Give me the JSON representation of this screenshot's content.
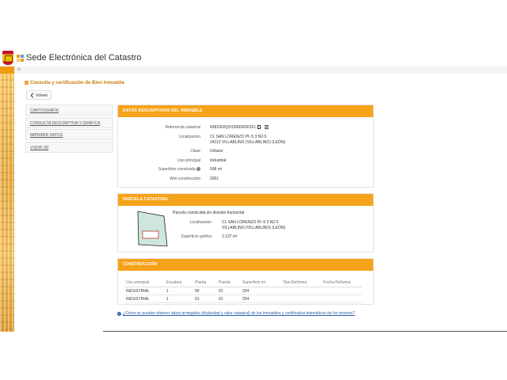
{
  "header": {
    "site_title": "Sede Electrónica del Catastro",
    "colors": {
      "accent": "#f5a31a",
      "title_text": "#c87d0e",
      "link": "#2b5ea7"
    }
  },
  "page": {
    "title": "Consulta y certificación de Bien Inmueble",
    "back_label": "Volver"
  },
  "sidebar": {
    "items": [
      {
        "label": "CARTOGRAFÍA"
      },
      {
        "label": "CONSULTA DESCRIPTIVA Y GRÁFICA"
      },
      {
        "label": "IMPRIMIR DATOS"
      },
      {
        "label": "VISOR 3D"
      }
    ]
  },
  "descriptivos": {
    "heading": "DATOS DESCRIPTIVOS DEL INMUEBLE",
    "ref_label": "Referencia catastral",
    "ref_value": "6582302QH1568S0001FL",
    "loc_label": "Localización",
    "loc_line1": "CL SAN LORENZO Pl:-5 3 N2-5",
    "loc_line2": "24112 VILLABLINO (VILLABLINO) (LEÓN)",
    "clase_label": "Clase",
    "clase_value": "Urbano",
    "uso_label": "Uso principal",
    "uso_value": "Industrial",
    "sup_label": "Superficie construida",
    "sup_value": "508 m²",
    "ano_label": "Año construcción",
    "ano_value": "2001"
  },
  "parcela": {
    "heading": "PARCELA CATASTRAL",
    "desc": "Parcela construida sin división horizontal",
    "loc_label": "Localización",
    "loc_line1": "CL SAN LORENZO Pl:-5 3 N2-5",
    "loc_line2": "VILLABLINO (VILLABLINO) (LEÓN)",
    "sup_label": "Superficie gráfica",
    "sup_value": "2.137 m²"
  },
  "construccion": {
    "heading": "CONSTRUCCIÓN",
    "columns": [
      "Uso principal",
      "Escalera",
      "Planta",
      "Puerta",
      "Superficie m²",
      "Tipo Reforma",
      "Fecha Reforma"
    ],
    "rows": [
      [
        "INDUSTRIAL",
        "1",
        "00",
        "01",
        "254",
        "",
        ""
      ],
      [
        "INDUSTRIAL",
        "1",
        "01",
        "01",
        "254",
        "",
        ""
      ]
    ]
  },
  "help_link": "¿Cómo se pueden obtener datos protegidos (titularidad y valor catastral) de los inmuebles y certificados telemáticos de los mismos?"
}
